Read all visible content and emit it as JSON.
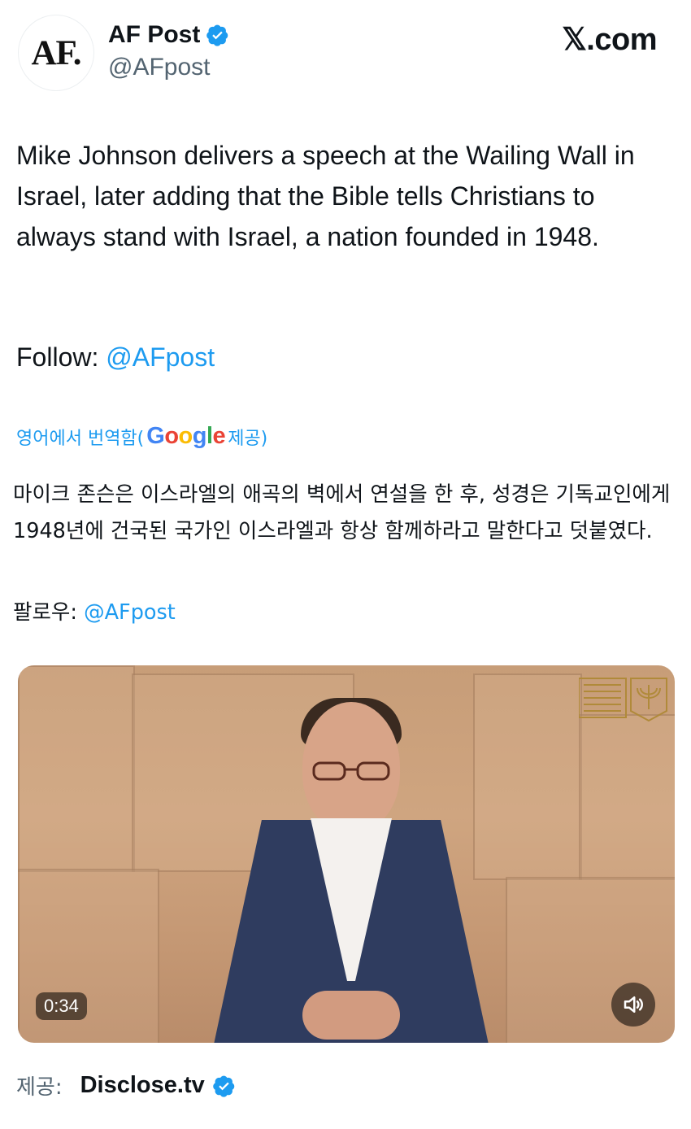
{
  "author": {
    "avatar_text": "AF.",
    "name": "AF Post",
    "handle": "@AFpost",
    "verified_icon": "verified-badge-icon"
  },
  "site": {
    "label": "𝕏.com"
  },
  "tweet": {
    "text": "Mike Johnson delivers a speech at the Wailing Wall in Israel, later adding that the Bible tells Christians to always stand with Israel, a nation founded in 1948.",
    "follow_prefix": "Follow: ",
    "follow_handle": "@AFpost"
  },
  "translation": {
    "label": "영어에서 번역함(",
    "google": [
      "G",
      "o",
      "o",
      "g",
      "l",
      "e"
    ],
    "suffix": " 제공)",
    "text": "마이크 존슨은 이스라엘의 애곡의 벽에서 연설을 한 후, 성경은 기독교인에게 1948년에 건국된 국가인 이스라엘과 항상 함께하라고 말한다고 덧붙였다.",
    "follow_prefix": "팔로우: ",
    "follow_handle": "@AFpost"
  },
  "video": {
    "duration": "0:34",
    "mute_icon": "speaker-icon"
  },
  "provider": {
    "label": "제공:",
    "source": "Disclose.tv"
  },
  "colors": {
    "link": "#1d9bf0",
    "text": "#0f1419",
    "secondary": "#536471"
  }
}
